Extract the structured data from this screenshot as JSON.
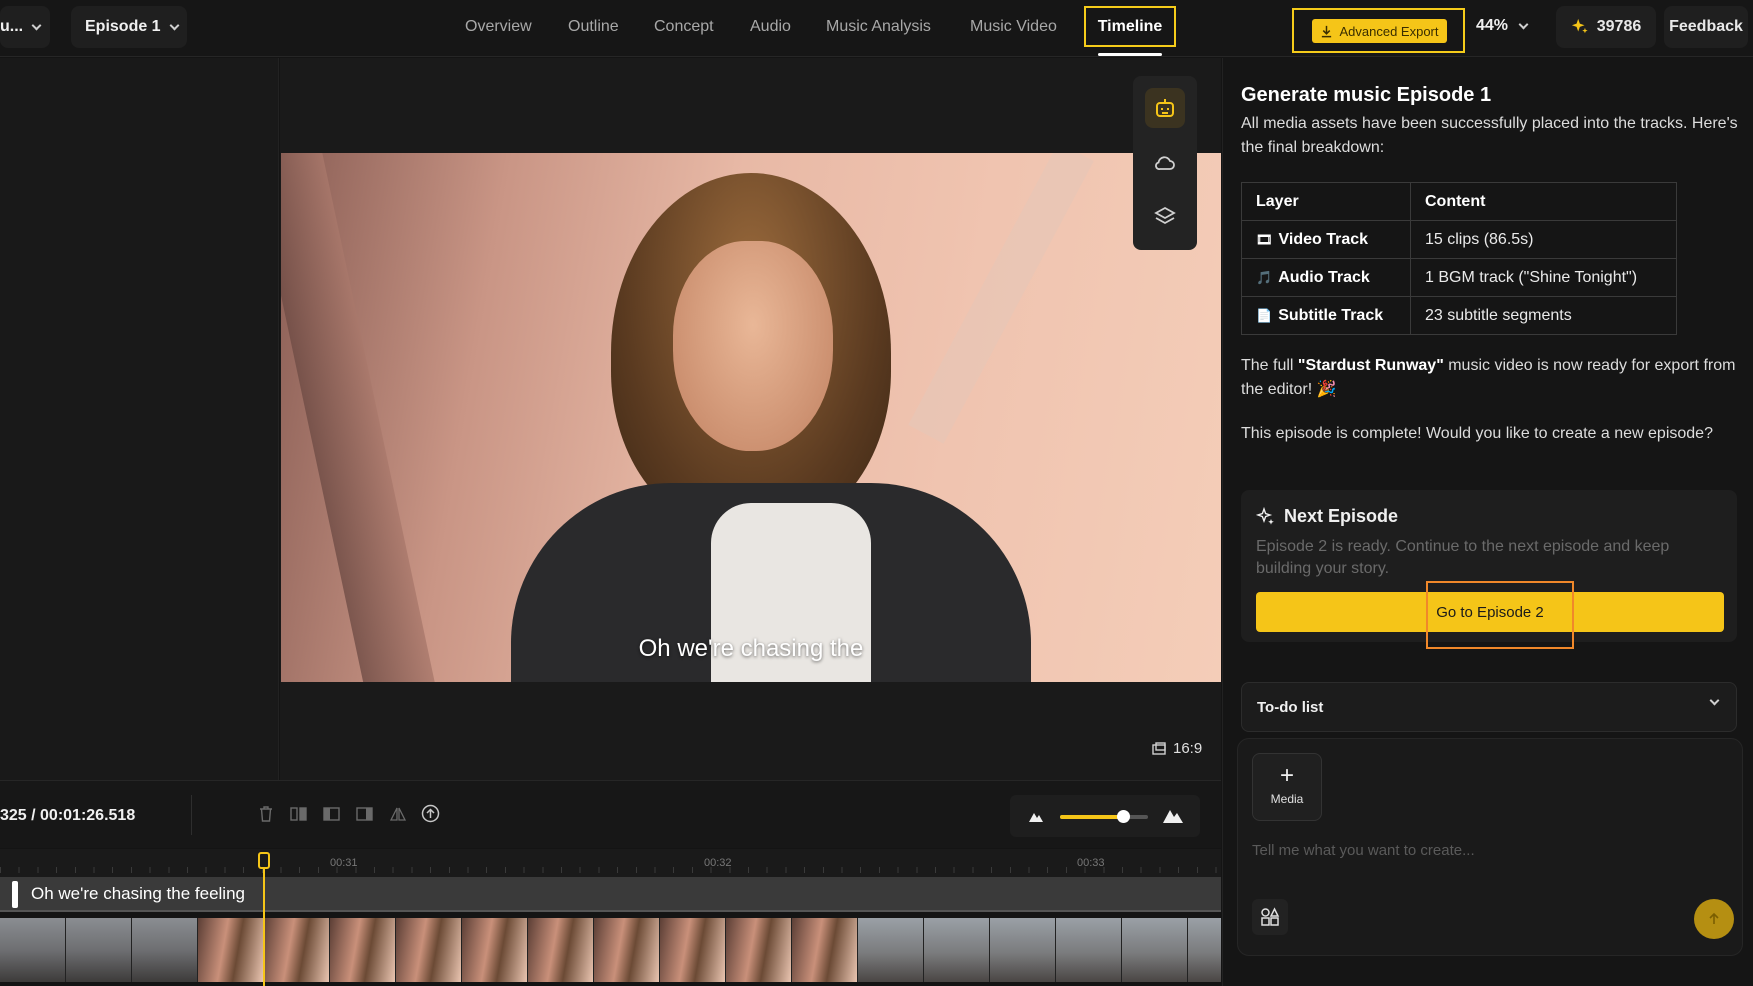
{
  "topbar": {
    "project_label": "u...",
    "episode_label": "Episode 1",
    "tabs": [
      "Overview",
      "Outline",
      "Concept",
      "Audio",
      "Music Analysis",
      "Music Video"
    ],
    "active_tab": "Timeline",
    "export_label": "Advanced Export",
    "zoom": "44%",
    "credits": "39786",
    "feedback": "Feedback"
  },
  "preview": {
    "subtitle": "Oh we're chasing the",
    "aspect_ratio": "16:9",
    "tools": [
      "robot-icon",
      "cloud-icon",
      "layers-icon"
    ]
  },
  "timeline": {
    "timecode": "325 / 00:01:26.518",
    "ticks": [
      "00:31",
      "00:32",
      "00:33"
    ],
    "subtitle_clip": "Oh we're chasing the feeling",
    "zoom_fraction": 0.72
  },
  "chat": {
    "title": "Generate music Episode 1",
    "intro": "All media assets have been successfully placed into the tracks. Here's the final breakdown:",
    "table": {
      "headers": [
        "Layer",
        "Content"
      ],
      "rows": [
        {
          "icon": "🎞",
          "layer": "Video Track",
          "content": "15 clips (86.5s)"
        },
        {
          "icon": "🎵",
          "layer": "Audio Track",
          "content": "1 BGM track (\"Shine Tonight\")"
        },
        {
          "icon": "📄",
          "layer": "Subtitle Track",
          "content": "23 subtitle segments"
        }
      ]
    },
    "ready_prefix": "The full ",
    "ready_title": "\"Stardust Runway\"",
    "ready_suffix": " music video is now ready for export from the editor! 🎉",
    "complete": "This episode is complete! Would you like to create a new episode?",
    "next_card": {
      "title": "Next Episode",
      "desc": "Episode 2 is ready. Continue to the next episode and keep building your story.",
      "button": "Go to Episode 2"
    },
    "todo_label": "To-do list",
    "composer": {
      "media_label": "Media",
      "placeholder": "Tell me what you want to create..."
    }
  },
  "colors": {
    "accent": "#f5c518",
    "highlight_box": "#f5cc1a",
    "focus_box": "#f0882a"
  }
}
